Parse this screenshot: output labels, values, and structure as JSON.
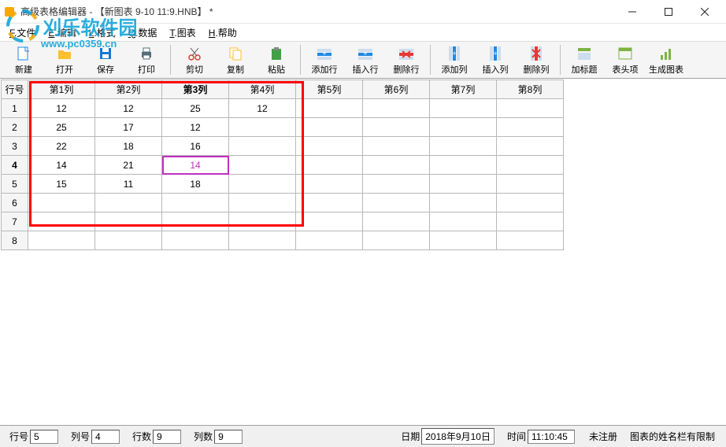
{
  "window": {
    "title": "高级表格编辑器 - 【新图表 9-10 11:9.HNB】 *"
  },
  "watermark": {
    "text": "刈乐软件园",
    "url": "www.pc0359.cn"
  },
  "menu": [
    {
      "label": "文件",
      "key": "F"
    },
    {
      "label": "编辑",
      "key": "E"
    },
    {
      "label": "格式",
      "key": "L"
    },
    {
      "label": "数据",
      "key": "Q"
    },
    {
      "label": "图表",
      "key": "T"
    },
    {
      "label": "帮助",
      "key": "H"
    }
  ],
  "toolbar": [
    {
      "name": "new",
      "label": "新建",
      "color": "#1e88e5"
    },
    {
      "name": "open",
      "label": "打开",
      "color": "#fbc02d"
    },
    {
      "name": "save",
      "label": "保存",
      "color": "#1976d2"
    },
    {
      "name": "print",
      "label": "打印",
      "color": "#546e7a"
    },
    {
      "sep": true
    },
    {
      "name": "cut",
      "label": "剪切",
      "color": "#e53935"
    },
    {
      "name": "copy",
      "label": "复制",
      "color": "#fbc02d"
    },
    {
      "name": "paste",
      "label": "粘贴",
      "color": "#43a047"
    },
    {
      "sep": true
    },
    {
      "name": "addrow",
      "label": "添加行",
      "color": "#1e88e5"
    },
    {
      "name": "insertrow",
      "label": "插入行",
      "color": "#1e88e5"
    },
    {
      "name": "delrow",
      "label": "删除行",
      "color": "#e53935"
    },
    {
      "sep": true
    },
    {
      "name": "addcol",
      "label": "添加列",
      "color": "#1e88e5"
    },
    {
      "name": "insertcol",
      "label": "插入列",
      "color": "#1e88e5"
    },
    {
      "name": "delcol",
      "label": "删除列",
      "color": "#e53935"
    },
    {
      "sep": true
    },
    {
      "name": "addtitle",
      "label": "加标题",
      "color": "#7cb342"
    },
    {
      "name": "tablehead",
      "label": "表头项",
      "color": "#7cb342"
    },
    {
      "name": "genchart",
      "label": "生成图表",
      "color": "#7cb342"
    }
  ],
  "grid": {
    "rowheader": "行号",
    "cols": [
      "第1列",
      "第2列",
      "第3列",
      "第4列",
      "第5列",
      "第6列",
      "第7列",
      "第8列"
    ],
    "activeCol": 2,
    "activeRow": 3,
    "rows": [
      [
        "12",
        "12",
        "25",
        "12",
        "",
        "",
        "",
        ""
      ],
      [
        "25",
        "17",
        "12",
        "",
        "",
        "",
        "",
        ""
      ],
      [
        "22",
        "18",
        "16",
        "",
        "",
        "",
        "",
        ""
      ],
      [
        "14",
        "21",
        "14",
        "",
        "",
        "",
        "",
        ""
      ],
      [
        "15",
        "11",
        "18",
        "",
        "",
        "",
        "",
        ""
      ],
      [
        "",
        "",
        "",
        "",
        "",
        "",
        "",
        ""
      ],
      [
        "",
        "",
        "",
        "",
        "",
        "",
        "",
        ""
      ],
      [
        "",
        "",
        "",
        "",
        "",
        "",
        "",
        ""
      ]
    ],
    "selected": {
      "row": 3,
      "col": 2
    }
  },
  "status": {
    "row_label": "行号",
    "row": "5",
    "col_label": "列号",
    "col": "4",
    "rows_label": "行数",
    "rows": "9",
    "cols_label": "列数",
    "cols": "9",
    "date_label": "日期",
    "date": "2018年9月10日",
    "time_label": "时间",
    "time": "11:10:45",
    "reg": "未注册",
    "hint": "图表的姓名栏有限制"
  }
}
